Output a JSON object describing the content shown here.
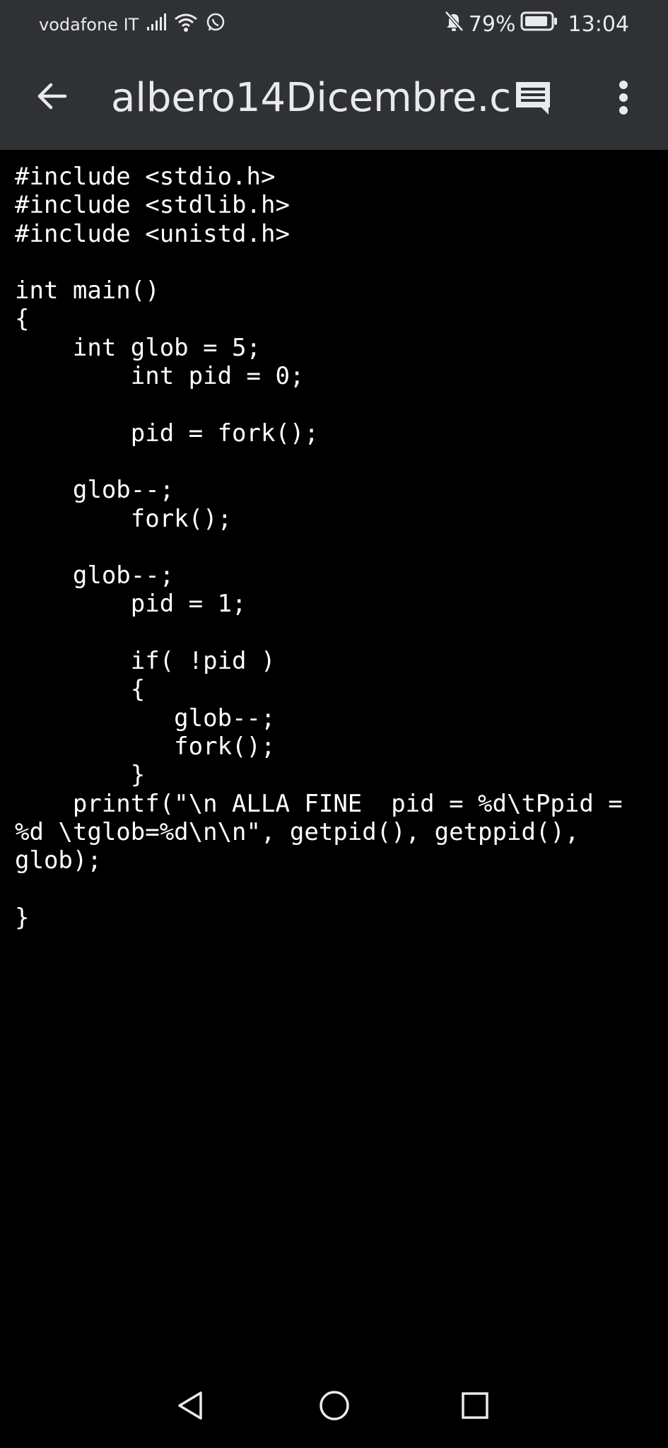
{
  "status_bar": {
    "carrier": "vodafone IT",
    "battery_percent": "79%",
    "time": "13:04",
    "icons": [
      "signal-icon",
      "wifi-icon",
      "whatsapp-icon",
      "mute-notifications-icon",
      "battery-icon"
    ]
  },
  "app_bar": {
    "title": "albero14Dicembre.c",
    "icons": [
      "back-arrow-icon",
      "comment-icon",
      "more-vert-icon"
    ]
  },
  "file": {
    "lines": [
      "#include <stdio.h>",
      "#include <stdlib.h>",
      "#include <unistd.h>",
      "",
      "int main()",
      "{",
      "    int glob = 5;",
      "        int pid = 0;",
      "",
      "        pid = fork();",
      "",
      "    glob--;",
      "        fork();",
      "",
      "    glob--;",
      "        pid = 1;",
      "",
      "        if( !pid )",
      "        {",
      "           glob--;",
      "           fork();",
      "        }",
      "    printf(\"\\n ALLA FINE  pid = %d\\tPpid =",
      "%d \\tglob=%d\\n\\n\", getpid(), getppid(),",
      "glob);",
      "",
      "}"
    ]
  },
  "nav_bar": {
    "icons": [
      "back-triangle-icon",
      "home-circle-icon",
      "recents-square-icon"
    ]
  },
  "colors": {
    "bar_background": "#303134",
    "bar_foreground": "#e8eaed",
    "code_background": "#000000",
    "code_text": "#ffffff"
  }
}
